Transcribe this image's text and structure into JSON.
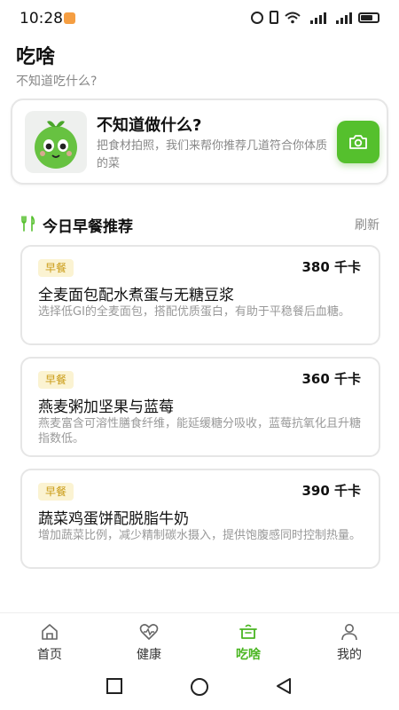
{
  "status_bar": {
    "time": "10:28"
  },
  "header": {
    "title": "吃啥",
    "subtitle": "不知道吃什么?"
  },
  "hero": {
    "title": "不知道做什么?",
    "description": "把食材拍照，我们来帮你推荐几道符合你体质的菜"
  },
  "section": {
    "title": "今日早餐推荐",
    "refresh_label": "刷新"
  },
  "meals": [
    {
      "tag": "早餐",
      "calories": "380 千卡",
      "name": "全麦面包配水煮蛋与无糖豆浆",
      "description": "选择低GI的全麦面包，搭配优质蛋白，有助于平稳餐后血糖。"
    },
    {
      "tag": "早餐",
      "calories": "360 千卡",
      "name": "燕麦粥加坚果与蓝莓",
      "description": "燕麦富含可溶性膳食纤维，能延缓糖分吸收，蓝莓抗氧化且升糖指数低。"
    },
    {
      "tag": "早餐",
      "calories": "390 千卡",
      "name": "蔬菜鸡蛋饼配脱脂牛奶",
      "description": "增加蔬菜比例，减少精制碳水摄入，提供饱腹感同时控制热量。"
    }
  ],
  "tabs": [
    {
      "label": "首页",
      "icon": "home-icon"
    },
    {
      "label": "健康",
      "icon": "heart-pulse-icon"
    },
    {
      "label": "吃啥",
      "icon": "pot-icon",
      "active": true
    },
    {
      "label": "我的",
      "icon": "person-icon"
    }
  ],
  "colors": {
    "accent": "#55c02d",
    "tag_text": "#c99a13",
    "tag_bg": "#fbf3d2"
  }
}
